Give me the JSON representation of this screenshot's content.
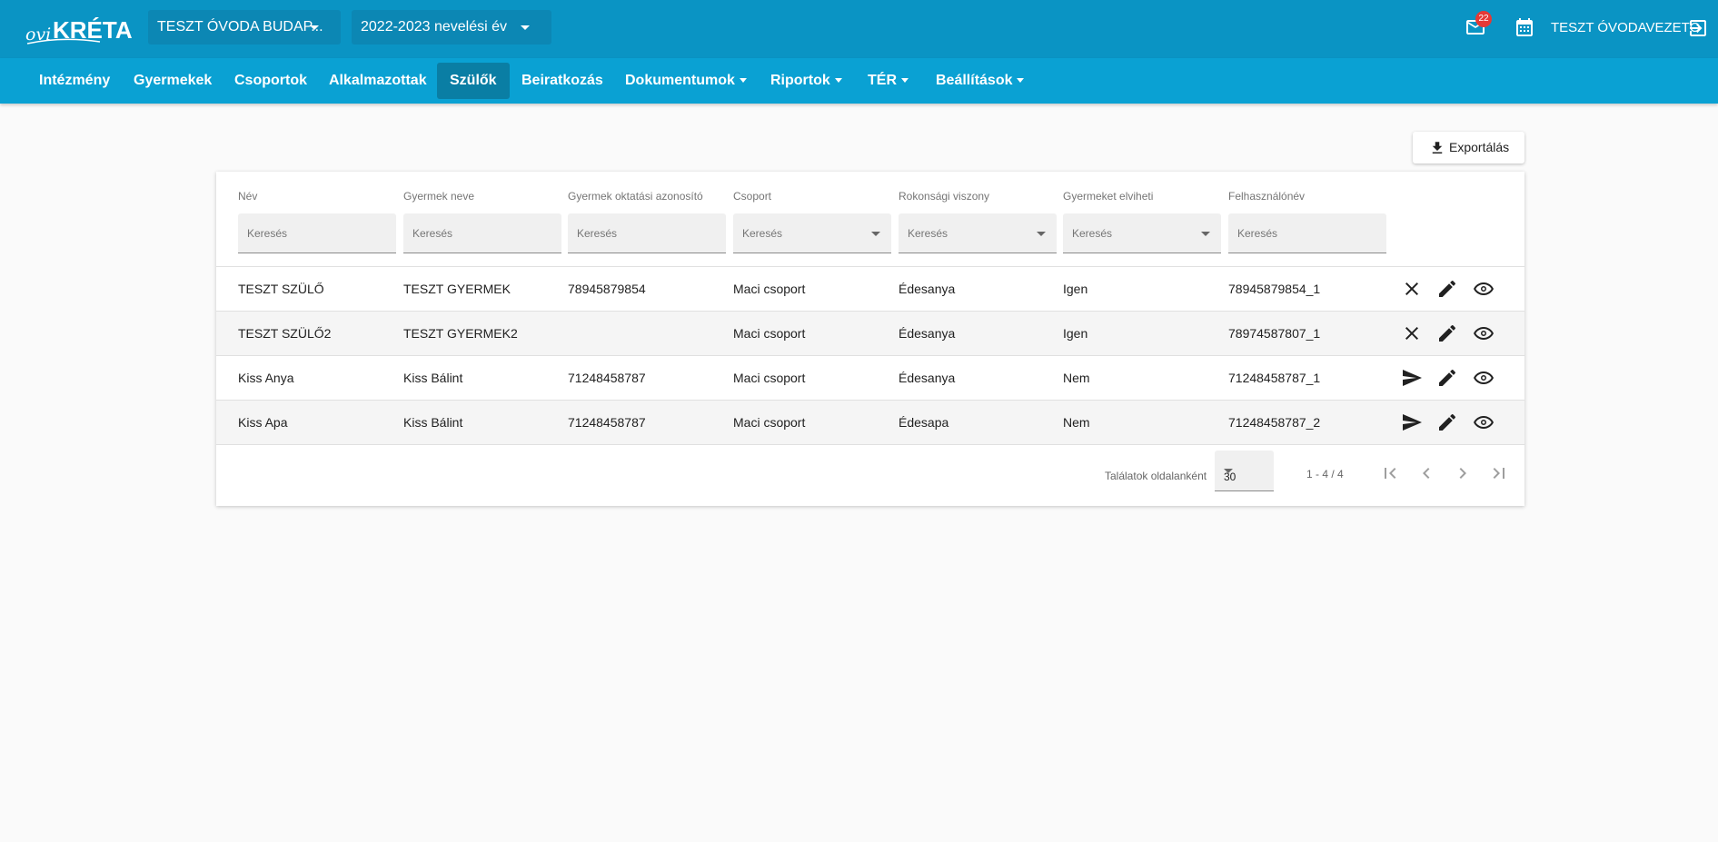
{
  "header": {
    "logo_text": "oviKRÉTA",
    "institution": "TESZT ÓVODA BUDAP...",
    "school_year": "2022-2023 nevelési év",
    "mail_count": "22",
    "user": "TESZT ÓVODAVEZETŐ"
  },
  "nav": {
    "items": [
      "Intézmény",
      "Gyermekek",
      "Csoportok",
      "Alkalmazottak",
      "Szülők",
      "Beiratkozás",
      "Dokumentumok",
      "Riportok",
      "TÉR",
      "Beállítások"
    ],
    "active": "Szülők"
  },
  "toolbar": {
    "export_label": "Exportálás"
  },
  "table": {
    "columns": [
      "Név",
      "Gyermek neve",
      "Gyermek oktatási azonosító",
      "Csoport",
      "Rokonsági viszony",
      "Gyermeket elviheti",
      "Felhasználónév"
    ],
    "search_placeholder": "Keresés",
    "rows": [
      {
        "name": "TESZT SZÜLŐ",
        "child": "TESZT GYERMEK",
        "child_id": "78945879854",
        "group": "Maci csoport",
        "relation": "Édesanya",
        "can_take": "Igen",
        "username": "78945879854_1",
        "first_action": "close"
      },
      {
        "name": "TESZT SZÜLŐ2",
        "child": "TESZT GYERMEK2",
        "child_id": "",
        "group": "Maci csoport",
        "relation": "Édesanya",
        "can_take": "Igen",
        "username": "78974587807_1",
        "first_action": "close"
      },
      {
        "name": "Kiss Anya",
        "child": "Kiss Bálint",
        "child_id": "71248458787",
        "group": "Maci csoport",
        "relation": "Édesanya",
        "can_take": "Nem",
        "username": "71248458787_1",
        "first_action": "send"
      },
      {
        "name": "Kiss Apa",
        "child": "Kiss Bálint",
        "child_id": "71248458787",
        "group": "Maci csoport",
        "relation": "Édesapa",
        "can_take": "Nem",
        "username": "71248458787_2",
        "first_action": "send"
      }
    ]
  },
  "pager": {
    "label": "Találatok oldalanként",
    "page_size": "30",
    "range": "1 - 4 / 4"
  },
  "colors": {
    "header": "#0a94c4",
    "navbar": "#0aa1d3",
    "active_nav": "#0a7ea4"
  }
}
